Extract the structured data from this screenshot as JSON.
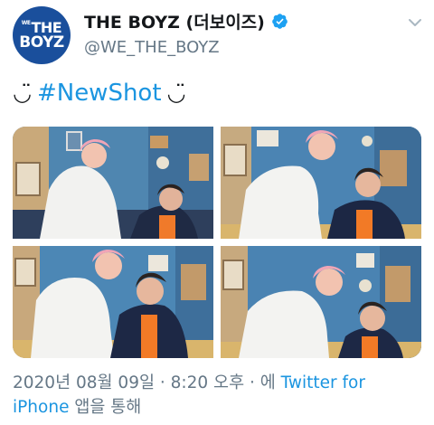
{
  "account": {
    "avatar_line1_small": "WE",
    "avatar_line1": "THE",
    "avatar_line2": "BOYZ",
    "display_name": "THE BOYZ (더보이즈)",
    "handle": "@WE_THE_BOYZ"
  },
  "tweet": {
    "smile_left": "◡̈",
    "hashtag": "#NewShot",
    "smile_right": "◡̈"
  },
  "photos": [
    {
      "label": "photo 1"
    },
    {
      "label": "photo 2"
    },
    {
      "label": "photo 3"
    },
    {
      "label": "photo 4"
    }
  ],
  "meta": {
    "timestamp": "2020년 08월 09일 · 8:20 오후 · 에 ",
    "source_link": "Twitter for",
    "source_link2": "iPhone",
    "suffix": " 앱을 통해"
  },
  "colors": {
    "link": "#1b95e0",
    "muted": "#657786",
    "brand": "#1a4f9c"
  },
  "icons": [
    "verified-badge-icon",
    "chevron-down-icon"
  ]
}
